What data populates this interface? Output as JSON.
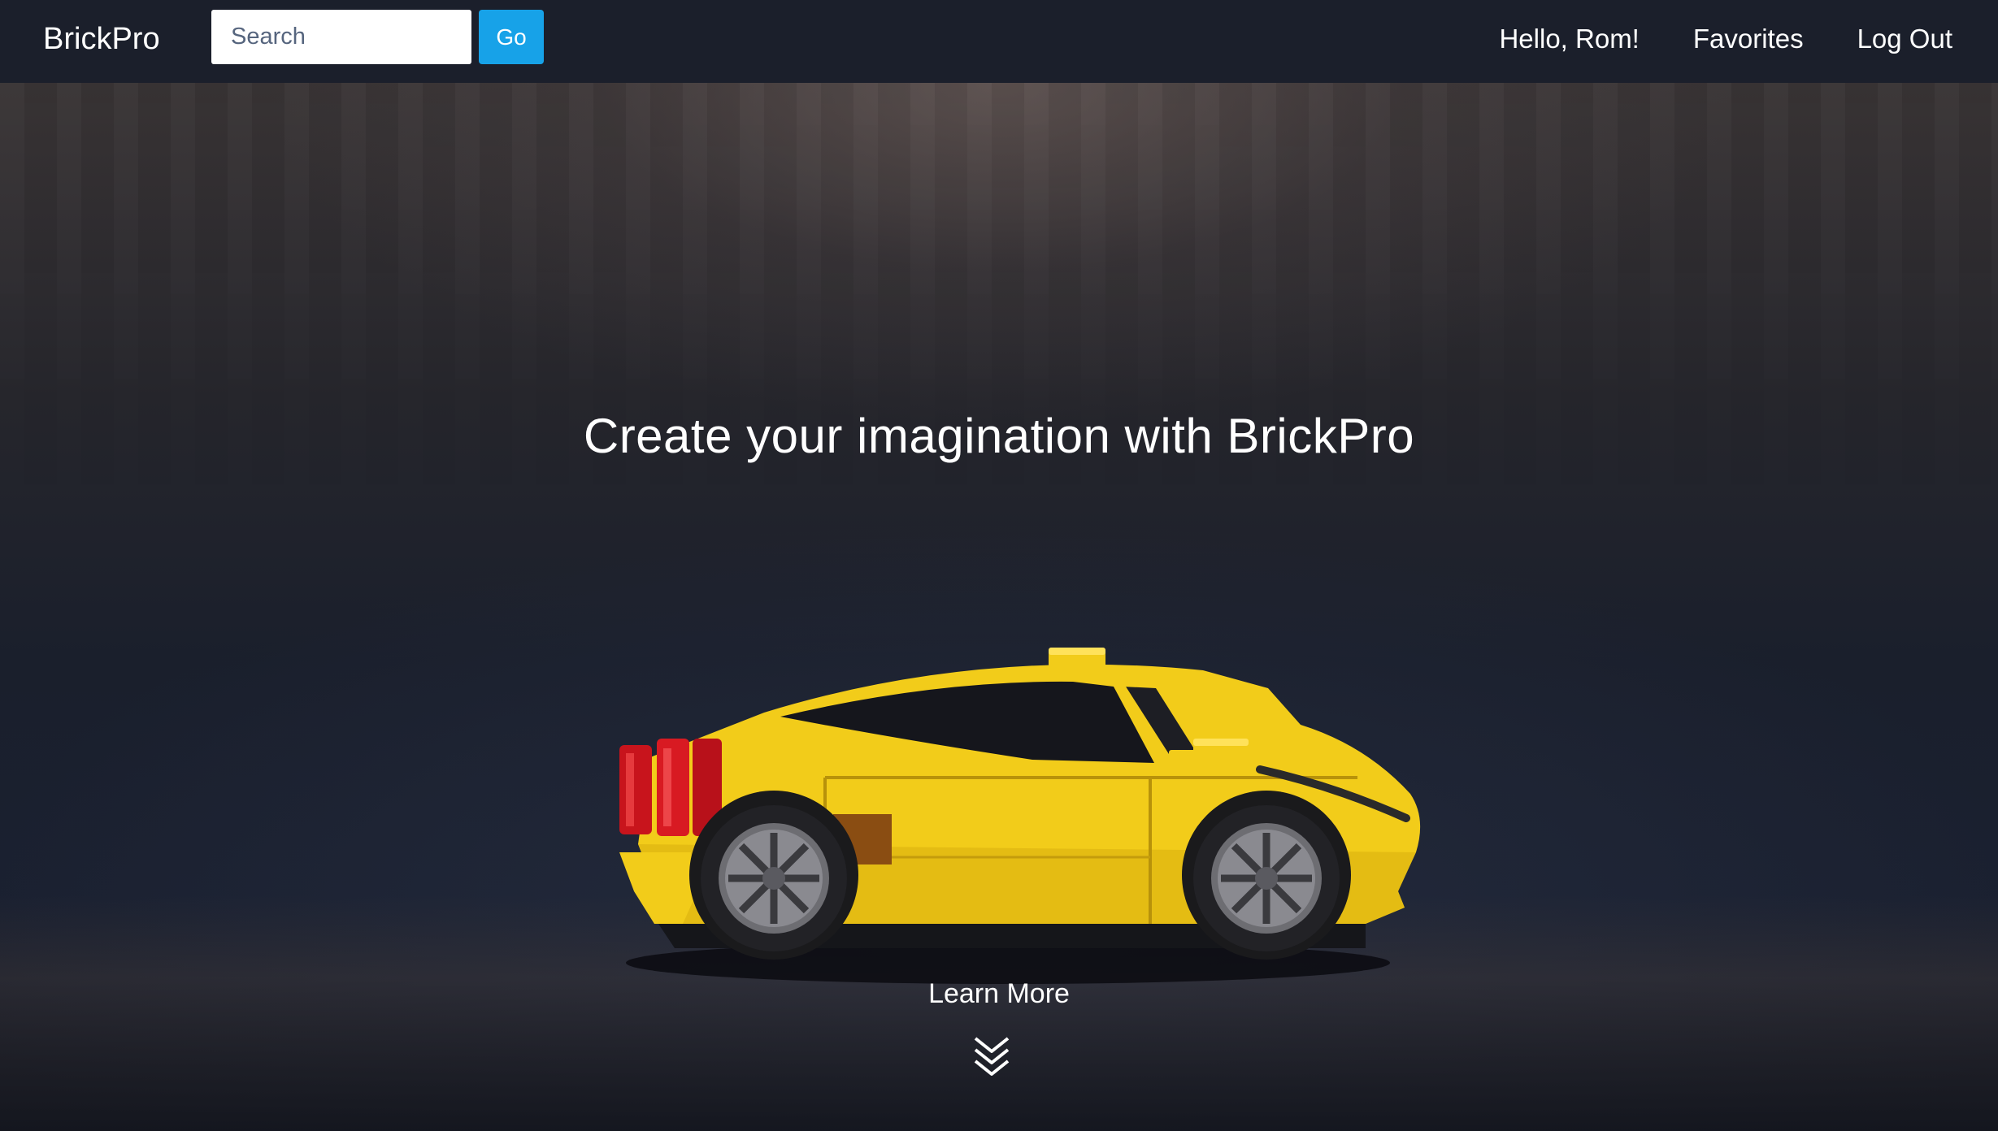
{
  "navbar": {
    "brand": "BrickPro",
    "search": {
      "placeholder": "Search",
      "value": ""
    },
    "go_label": "Go",
    "links": {
      "greeting": "Hello, Rom!",
      "favorites": "Favorites",
      "logout": "Log Out"
    }
  },
  "hero": {
    "title": "Create your imagination with BrickPro",
    "learn_more": "Learn More",
    "scroll_icon": "double-chevron-down-icon",
    "image": "yellow-brick-sports-car"
  },
  "colors": {
    "navbar_bg": "#1b1f2b",
    "accent": "#17a2e8",
    "car_yellow": "#f2cc1a",
    "taillight_red": "#c8141c"
  }
}
